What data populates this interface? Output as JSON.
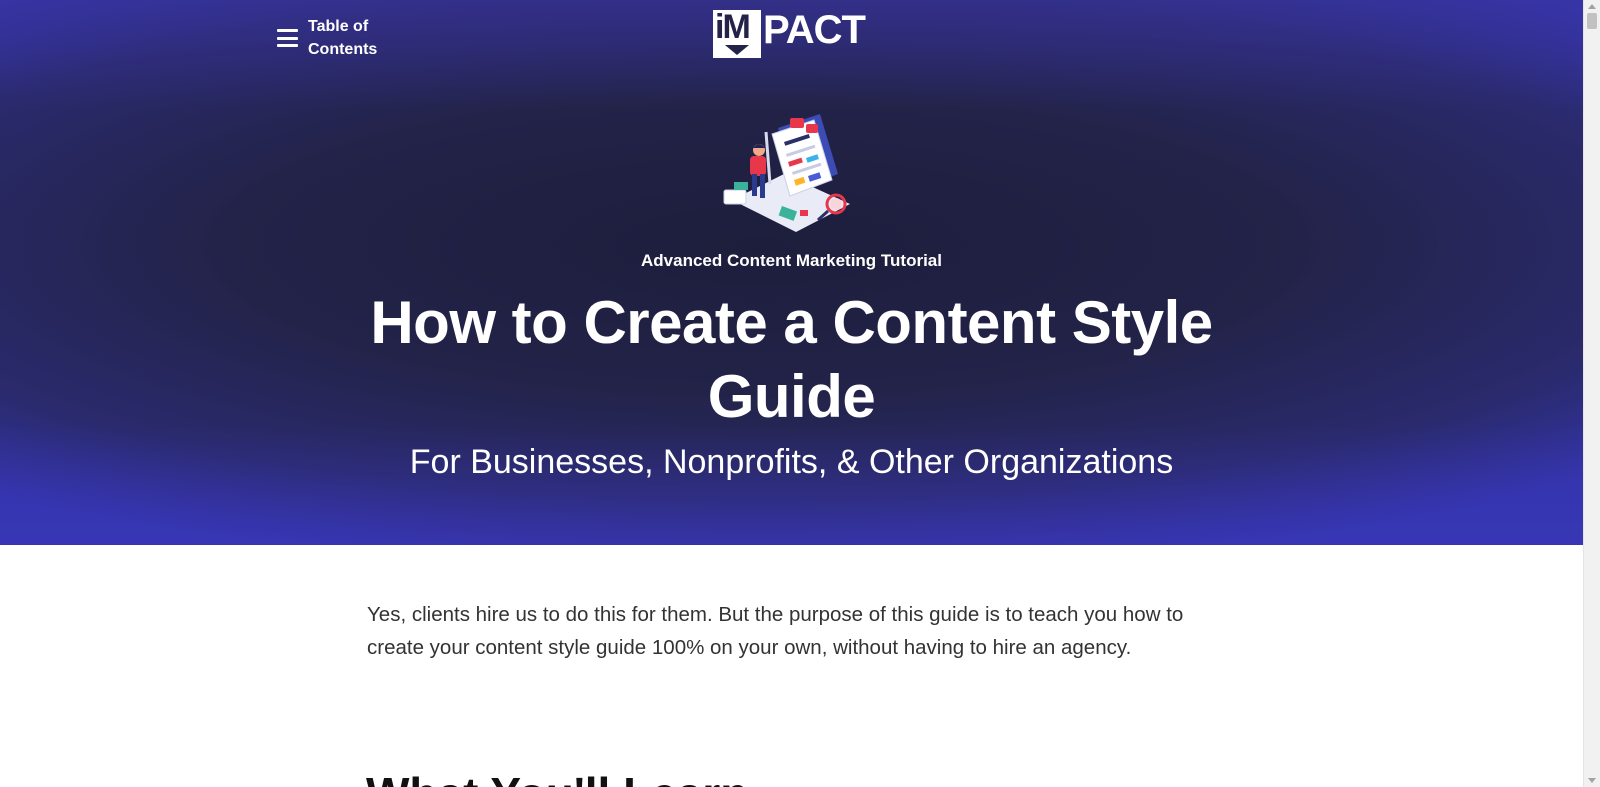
{
  "header": {
    "toc_label": "Table of Contents",
    "logo_text": "PACT",
    "logo_mark": "iM"
  },
  "hero": {
    "eyebrow": "Advanced Content Marketing Tutorial",
    "title": "How to Create a Content Style Guide",
    "subtitle": "For Businesses, Nonprofits, & Other Organizations",
    "illustration_icon": "content-editor-illustration"
  },
  "main": {
    "intro": "Yes, clients hire us to do this for them. But the purpose of this guide is to teach you how to create your content style guide 100% on your own, without having to hire an agency.",
    "section_heading": "What You'll Learn"
  },
  "colors": {
    "hero_dark": "#1d1d3c",
    "hero_accent": "#3434ac",
    "text_white": "#ffffff",
    "body_text": "#333333"
  }
}
